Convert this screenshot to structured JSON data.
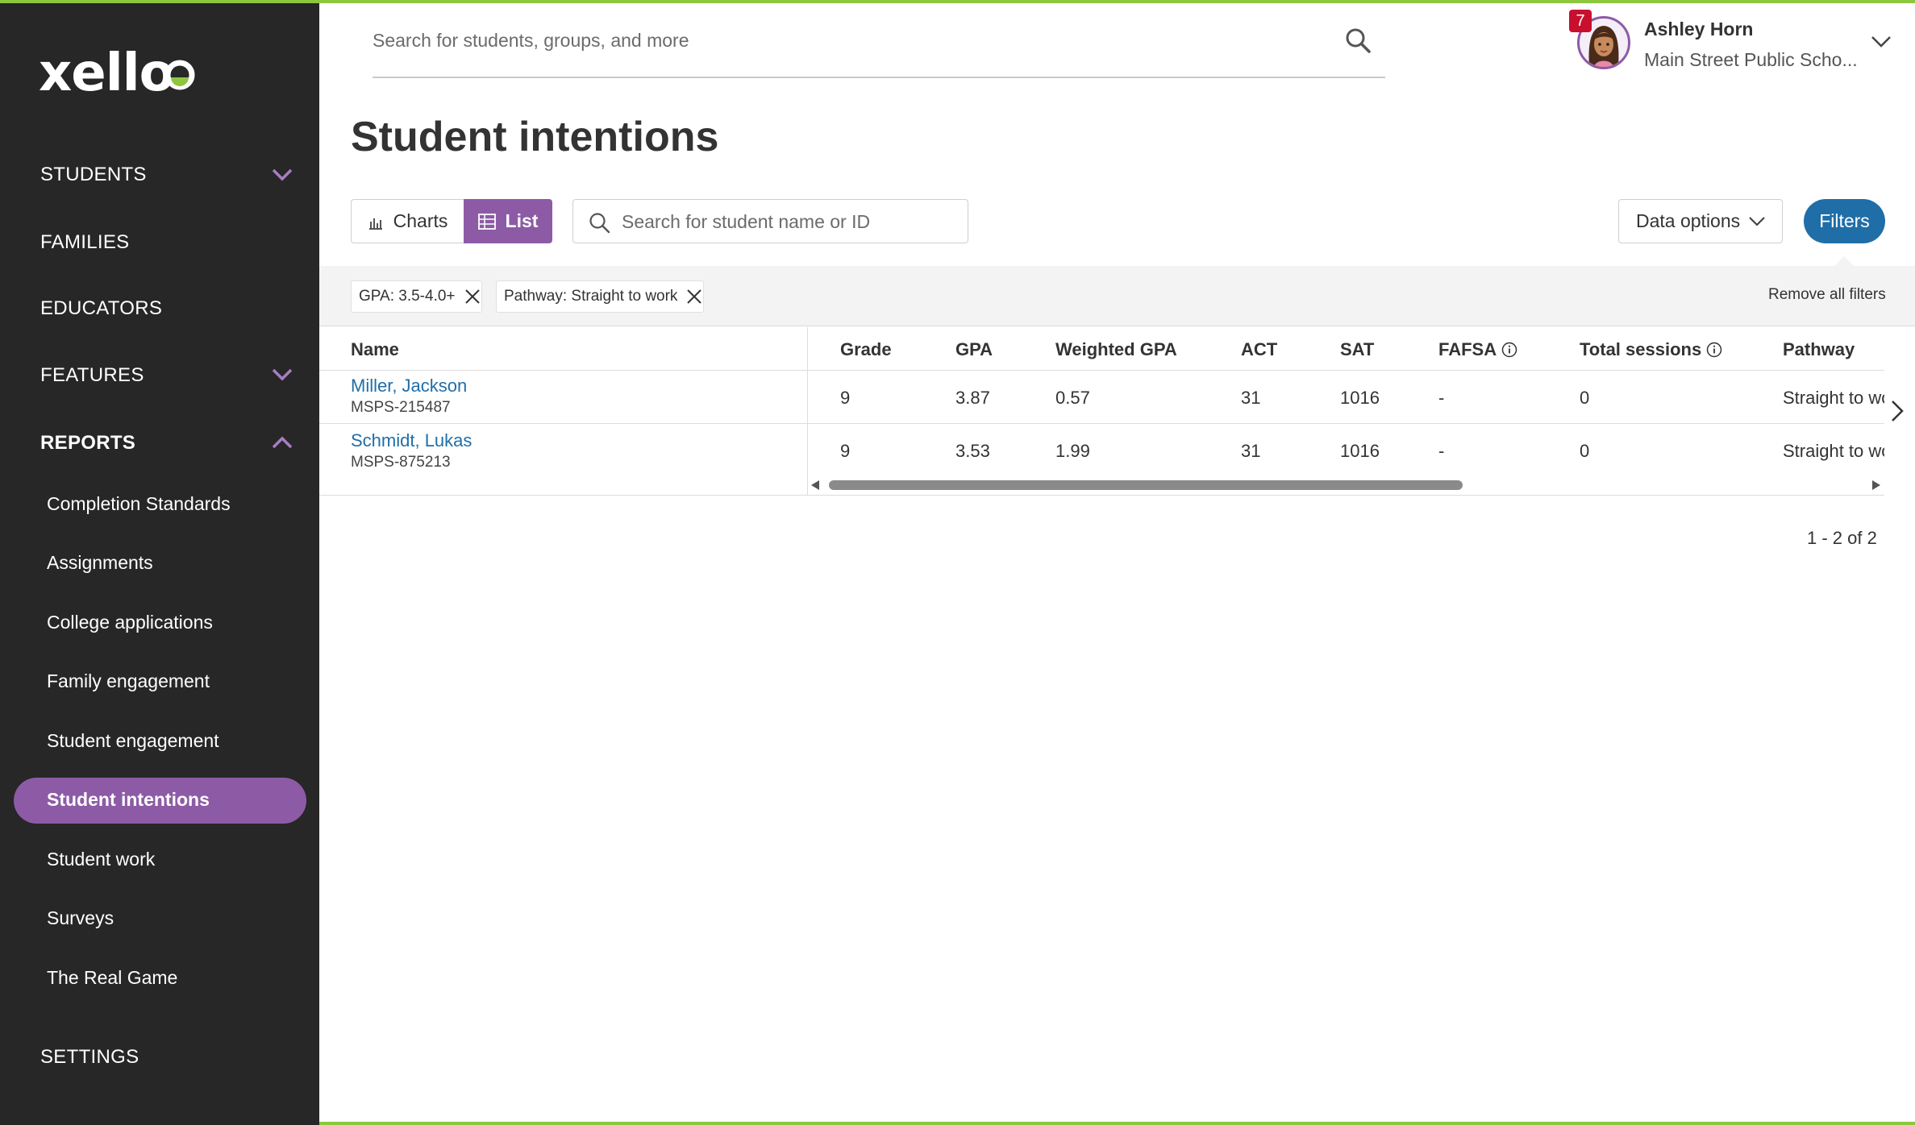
{
  "app": {
    "brand": "xello",
    "accent": "#8d5ba6",
    "link_color": "#1f6ea8",
    "sidebar_bg": "#272727",
    "top_bar_color": "#8dc63f"
  },
  "sidebar": {
    "students": "STUDENTS",
    "families": "FAMILIES",
    "educators": "EDUCATORS",
    "features": "FEATURES",
    "reports": "REPORTS",
    "settings": "SETTINGS",
    "report_items": [
      "Completion Standards",
      "Assignments",
      "College applications",
      "Family engagement",
      "Student engagement",
      "Student intentions",
      "Student work",
      "Surveys",
      "The Real Game"
    ],
    "active_item": "Student intentions"
  },
  "header": {
    "search_placeholder": "Search for students, groups, and more",
    "notifications": "7",
    "user_name": "Ashley Horn",
    "school": "Main Street Public Scho..."
  },
  "page": {
    "title": "Student intentions"
  },
  "toolbar": {
    "charts_label": "Charts",
    "list_label": "List",
    "active_view": "List",
    "search_placeholder": "Search for student name or ID",
    "data_options_label": "Data options",
    "filters_label": "Filters"
  },
  "filters": {
    "chips": [
      "GPA: 3.5-4.0+",
      "Pathway: Straight to work"
    ],
    "remove_all": "Remove all filters"
  },
  "table": {
    "columns": [
      "Name",
      "Grade",
      "GPA",
      "Weighted GPA",
      "ACT",
      "SAT",
      "FAFSA",
      "Total sessions",
      "Pathway"
    ],
    "rows": [
      {
        "name": "Miller, Jackson",
        "id": "MSPS-215487",
        "grade": "9",
        "gpa": "3.87",
        "weighted_gpa": "0.57",
        "act": "31",
        "sat": "1016",
        "fafsa": "-",
        "total_sessions": "0",
        "pathway": "Straight to work"
      },
      {
        "name": "Schmidt, Lukas",
        "id": "MSPS-875213",
        "grade": "9",
        "gpa": "3.53",
        "weighted_gpa": "1.99",
        "act": "31",
        "sat": "1016",
        "fafsa": "-",
        "total_sessions": "0",
        "pathway": "Straight to work"
      }
    ]
  },
  "pagination": {
    "label": "1 - 2 of 2"
  }
}
